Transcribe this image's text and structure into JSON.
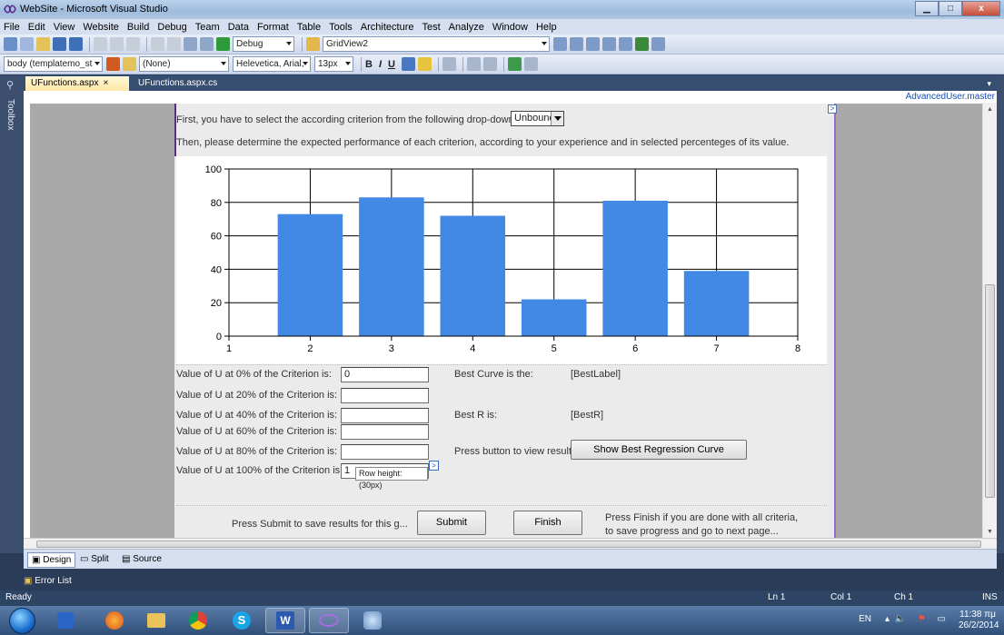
{
  "window": {
    "title": "WebSite - Microsoft Visual Studio",
    "minimize_icon": "minimize-icon",
    "maximize_icon": "maximize-icon",
    "close_label": "x"
  },
  "menu": [
    "File",
    "Edit",
    "View",
    "Website",
    "Build",
    "Debug",
    "Team",
    "Data",
    "Format",
    "Table",
    "Tools",
    "Architecture",
    "Test",
    "Analyze",
    "Window",
    "Help"
  ],
  "toolbar1": {
    "config_value": "Debug",
    "target_value": "GridView2"
  },
  "toolbar2": {
    "element_value": "body (templatemo_st",
    "style_value": "(None)",
    "font_value": "Helevetica, Arial,",
    "size_value": "13px",
    "bold": "B",
    "italic": "I",
    "underline": "U"
  },
  "toolbox_label": "Toolbox",
  "tabs": [
    {
      "label": "UFunctions.aspx",
      "close": "×"
    },
    {
      "label": "UFunctions.aspx.cs"
    }
  ],
  "master_label": "AdvancedUser.master",
  "page": {
    "intro1": "First, you have to select the according criterion from the following drop-down menu",
    "dropdown_value": "Unbound",
    "intro2": "Then, please determine the expected performance of each criterion, according to your experience and in selected percenteges of its value."
  },
  "chart_data": {
    "type": "bar",
    "x": [
      2,
      3,
      4,
      5,
      6,
      7
    ],
    "values": [
      73,
      83,
      72,
      22,
      81,
      39
    ],
    "xlim": [
      1,
      8
    ],
    "ylim": [
      0,
      100
    ],
    "xticks": [
      "1",
      "2",
      "3",
      "4",
      "5",
      "6",
      "7",
      "8"
    ],
    "yticks": [
      "0",
      "20",
      "40",
      "60",
      "80",
      "100"
    ],
    "grid": true,
    "bar_color": "#4289e6"
  },
  "form": {
    "rows": [
      {
        "label": "Value of U at 0% of the Criterion is:",
        "value": "0"
      },
      {
        "label": "Value of U at 20% of the Criterion is:",
        "value": ""
      },
      {
        "label": "Value of U at 40% of the Criterion is:",
        "value": ""
      },
      {
        "label": "Value of U at 60% of the Criterion is:",
        "value": ""
      },
      {
        "label": "Value of U at 80% of the Criterion is:",
        "value": ""
      },
      {
        "label": "Value of U at 100% of the Criterion is:",
        "value": "1"
      }
    ],
    "best_curve_label": "Best Curve is the:",
    "best_curve_value": "[BestLabel]",
    "best_r_label": "Best R is:",
    "best_r_value": "[BestR]",
    "press_button_label": "Press button to view results",
    "show_button": "Show Best Regression Curve",
    "tooltip": "Row height: (30px)"
  },
  "bottom": {
    "submit_hint": "Press Submit to save results for this g...",
    "submit_button": "Submit",
    "finish_button": "Finish",
    "finish_hint1": "Press Finish if you are done with all criteria,",
    "finish_hint2": "to save progress and go to next page..."
  },
  "views": {
    "design": "Design",
    "split": "Split",
    "source": "Source"
  },
  "error_list": "Error List",
  "status": {
    "ready": "Ready",
    "ln": "Ln 1",
    "col": "Col 1",
    "ch": "Ch 1",
    "ins": "INS"
  },
  "taskbar": {
    "lang": "EN",
    "time": "11:38 πμ",
    "date": "26/2/2014"
  }
}
